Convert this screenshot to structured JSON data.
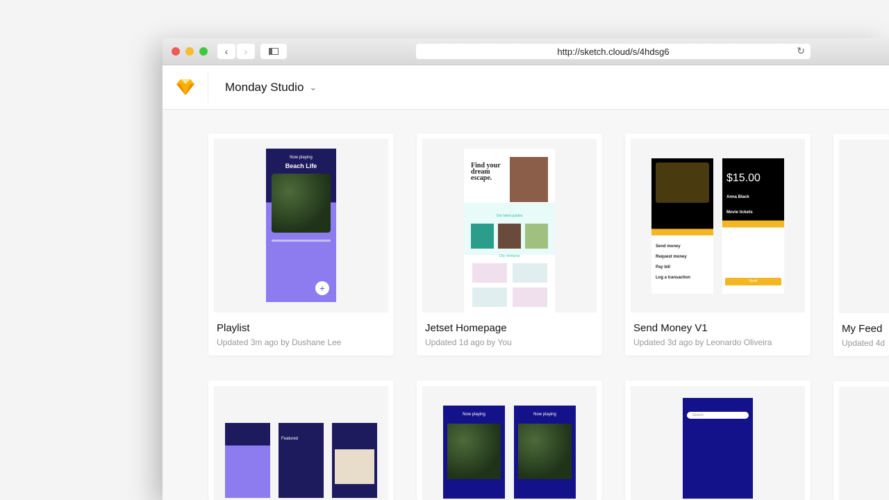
{
  "browser": {
    "url": "http://sketch.cloud/s/4hdsg6",
    "colors": {
      "close": "#ee5b56",
      "minimize": "#f5bd2f",
      "zoom": "#3ec840"
    }
  },
  "header": {
    "team_name": "Monday Studio"
  },
  "documents": [
    {
      "title": "Playlist",
      "meta": "Updated 3m ago by Dushane Lee",
      "preview": {
        "heading": "Now playing",
        "title": "Beach Life"
      }
    },
    {
      "title": "Jetset Homepage",
      "meta": "Updated 1d ago by You",
      "preview": {
        "headline": "Find your dream escape.",
        "section1": "Our latest guides",
        "section2": "City Ventures"
      }
    },
    {
      "title": "Send Money V1",
      "meta": "Updated 3d ago by Leonardo Oliveira",
      "preview": {
        "amount": "15.00",
        "to": "Anna Black",
        "for": "Movie tickets",
        "actions": [
          "Send money",
          "Request money",
          "Pay bill",
          "Log a transaction"
        ],
        "send": "Send"
      }
    },
    {
      "title": "My Feed",
      "meta": "Updated 4d"
    }
  ],
  "row2": [
    {
      "label": "Featured"
    },
    {
      "label": "Now playing"
    },
    {
      "label": "Search"
    }
  ]
}
